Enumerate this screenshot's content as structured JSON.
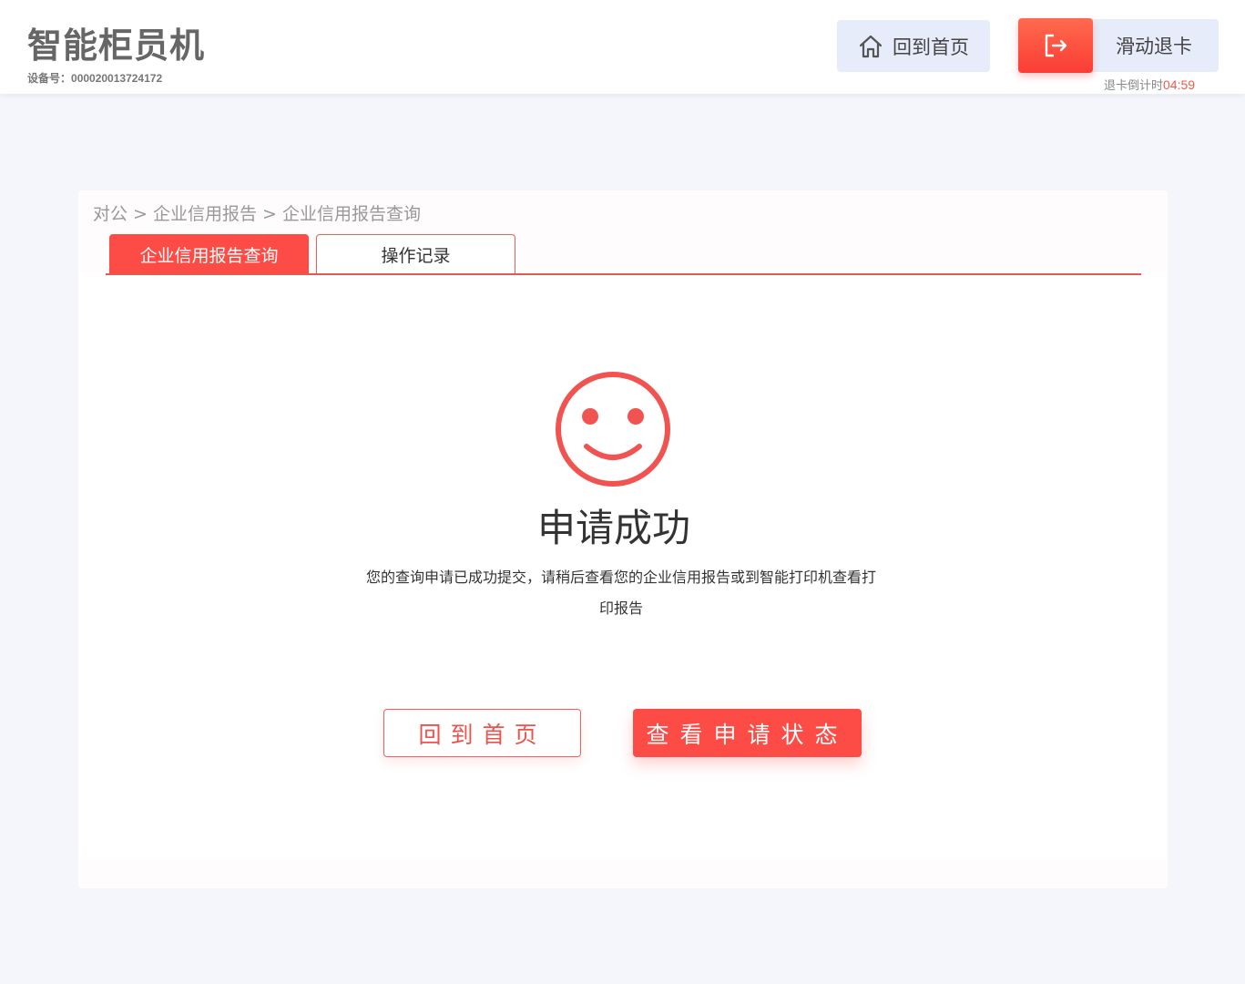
{
  "header": {
    "app_title": "智能柜员机",
    "device_label": "设备号：",
    "device_number": "000020013724172",
    "home_button_label": "回到首页",
    "exit_button_label": "滑动退卡",
    "countdown_label": "退卡倒计时",
    "countdown_time": "04:59"
  },
  "breadcrumb": {
    "text": "对公 > 企业信用报告 > 企业信用报告查询"
  },
  "tabs": [
    {
      "label": "企业信用报告查询",
      "active": true
    },
    {
      "label": "操作记录",
      "active": false
    }
  ],
  "result": {
    "icon": "smile-icon",
    "title": "申请成功",
    "description": "您的查询申请已成功提交，请稍后查看您的企业信用报告或到智能打印机查看打印报告"
  },
  "actions": {
    "home_label": "回到首页",
    "status_label": "查看申请状态"
  },
  "colors": {
    "accent": "#fc4c45",
    "background": "#f5f5fc",
    "button_light": "#e6ecf9"
  }
}
